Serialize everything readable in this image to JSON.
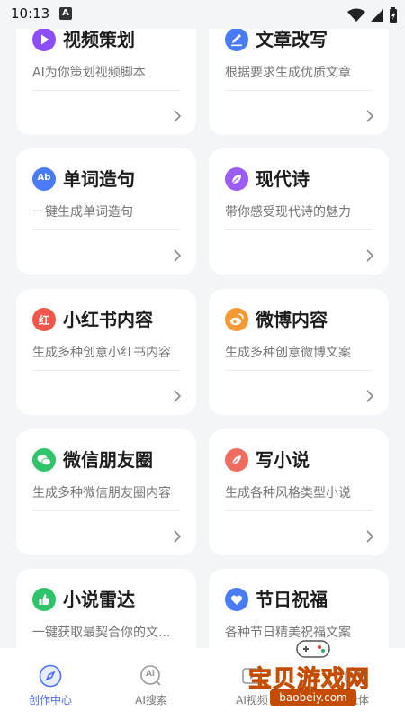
{
  "status_bar": {
    "time": "10:13",
    "notification_glyph": "A"
  },
  "colors": {
    "background": "#f4f5f9",
    "active_nav": "#4b70ff",
    "video": "#8c4dfa",
    "article": "#4a7bf7",
    "words": "#4a7bf7",
    "poem": "#9b5cf5",
    "xiaohongshu": "#f0564a",
    "weibo": "#f59a33",
    "wechat": "#2fc36a",
    "novel": "#f06c5e",
    "radar": "#2fc36a",
    "holiday": "#4a7bf7"
  },
  "cards": [
    {
      "title": "视频策划",
      "subtitle": "AI为你策划视频脚本",
      "icon": "play-icon"
    },
    {
      "title": "文章改写",
      "subtitle": "根据要求生成优质文章",
      "icon": "pen-icon"
    },
    {
      "title": "单词造句",
      "subtitle": "一键生成单词造句",
      "icon": "ab-icon",
      "icon_text": "Ab"
    },
    {
      "title": "现代诗",
      "subtitle": "带你感受现代诗的魅力",
      "icon": "leaf-icon"
    },
    {
      "title": "小红书内容",
      "subtitle": "生成多种创意小红书内容",
      "icon": "xiaohongshu-icon",
      "icon_text": "红"
    },
    {
      "title": "微博内容",
      "subtitle": "生成多种创意微博文案",
      "icon": "weibo-icon"
    },
    {
      "title": "微信朋友圈",
      "subtitle": "生成多种微信朋友圈内容",
      "icon": "wechat-icon"
    },
    {
      "title": "写小说",
      "subtitle": "生成各种风格类型小说",
      "icon": "feather-icon"
    },
    {
      "title": "小说雷达",
      "subtitle": "一键获取最契合你的文...",
      "icon": "thumb-up-icon"
    },
    {
      "title": "节日祝福",
      "subtitle": "各种节日精美祝福文案",
      "icon": "heart-icon"
    }
  ],
  "bottom_nav": [
    {
      "label": "创作中心",
      "icon": "compass-icon",
      "active": true
    },
    {
      "label": "AI搜索",
      "icon": "ai-search-icon",
      "icon_text": "Ai",
      "active": false
    },
    {
      "label": "AI视频",
      "icon": "video-icon",
      "active": false
    },
    {
      "label": "智能体",
      "icon": "agent-icon",
      "active": false
    }
  ],
  "watermark": {
    "text": "宝贝游戏网",
    "url": "baobeiy.com"
  }
}
